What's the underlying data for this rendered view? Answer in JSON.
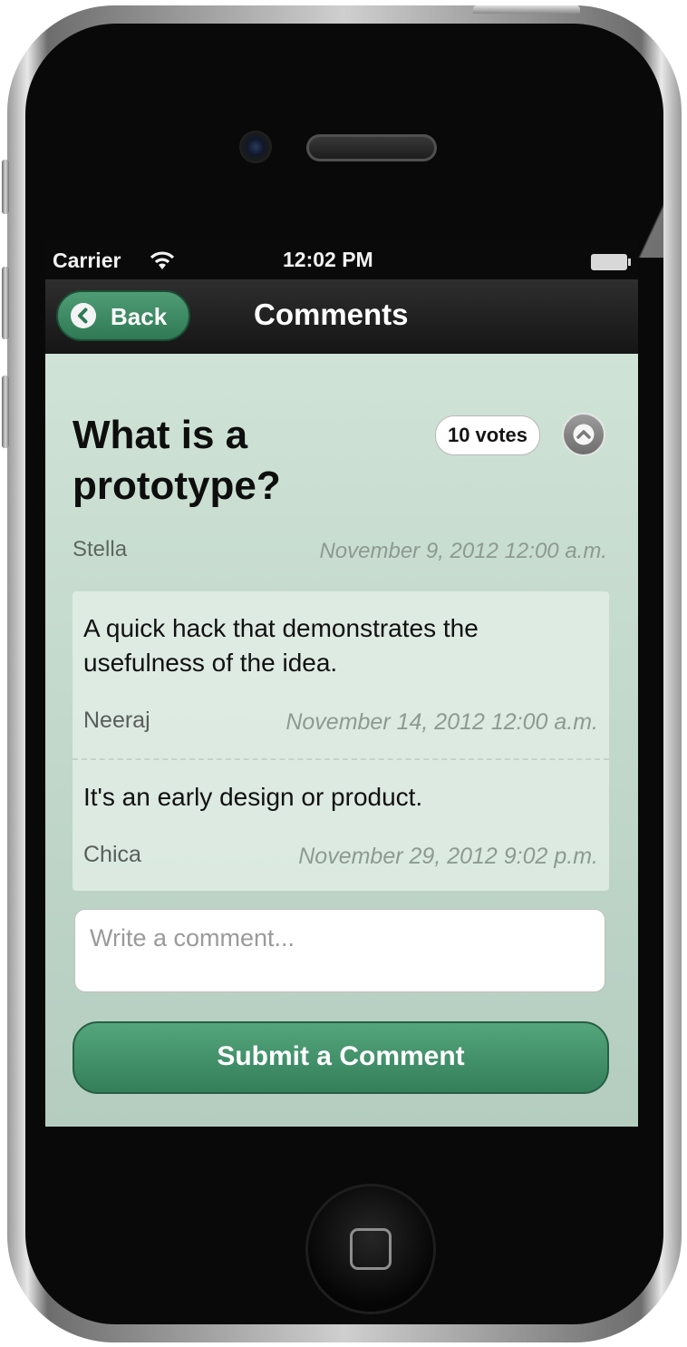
{
  "status_bar": {
    "carrier": "Carrier",
    "time": "12:02 PM",
    "wifi_icon": "wifi-icon",
    "battery_icon": "battery-full-icon"
  },
  "nav": {
    "back_label": "Back",
    "back_icon": "chevron-left-circle-icon",
    "title": "Comments"
  },
  "question": {
    "title": "What is a prototype?",
    "votes": "10 votes",
    "upvote_icon": "chevron-up-circle-icon",
    "author": "Stella",
    "date": "November 9, 2012 12:00 a.m."
  },
  "comments": [
    {
      "text": "A quick hack that demonstrates the usefulness of the idea.",
      "author": "Neeraj",
      "date": "November 14, 2012 12:00 a.m."
    },
    {
      "text": "It's an early design or product.",
      "author": "Chica",
      "date": "November 29, 2012 9:02 p.m."
    }
  ],
  "comment_form": {
    "placeholder": "Write a comment...",
    "submit_label": "Submit a Comment"
  },
  "colors": {
    "accent_green": "#3f8f68",
    "content_bg": "#c4dacd",
    "nav_bg": "#1f1f1f"
  },
  "device": {
    "home_button_icon": "home-square-icon"
  }
}
